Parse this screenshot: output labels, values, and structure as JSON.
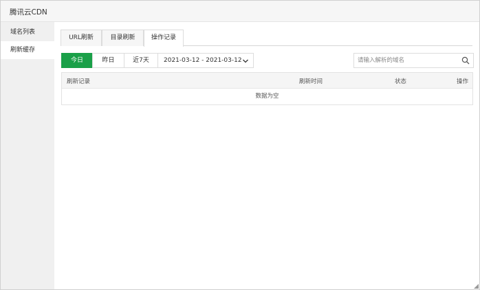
{
  "window": {
    "title": "腾讯云CDN"
  },
  "sidebar": {
    "items": [
      {
        "label": "域名列表"
      },
      {
        "label": "刷新缓存",
        "active": true
      }
    ]
  },
  "tabs": [
    {
      "label": "URL刷新"
    },
    {
      "label": "目录刷新"
    },
    {
      "label": "操作记录",
      "active": true
    }
  ],
  "filters": {
    "buttons": [
      {
        "label": "今日",
        "active": true
      },
      {
        "label": "昨日"
      },
      {
        "label": "近7天"
      }
    ],
    "date_range": "2021-03-12 - 2021-03-12"
  },
  "search": {
    "placeholder": "请输入解析的域名"
  },
  "table": {
    "columns": [
      "刷新记录",
      "刷新时间",
      "状态",
      "操作"
    ],
    "empty_text": "数据为空"
  },
  "colors": {
    "accent": "#1aa048",
    "sidebar_bg": "#f0f0f0"
  },
  "icons": {
    "date_dropdown": "chevron-down-icon",
    "search": "search-icon"
  }
}
